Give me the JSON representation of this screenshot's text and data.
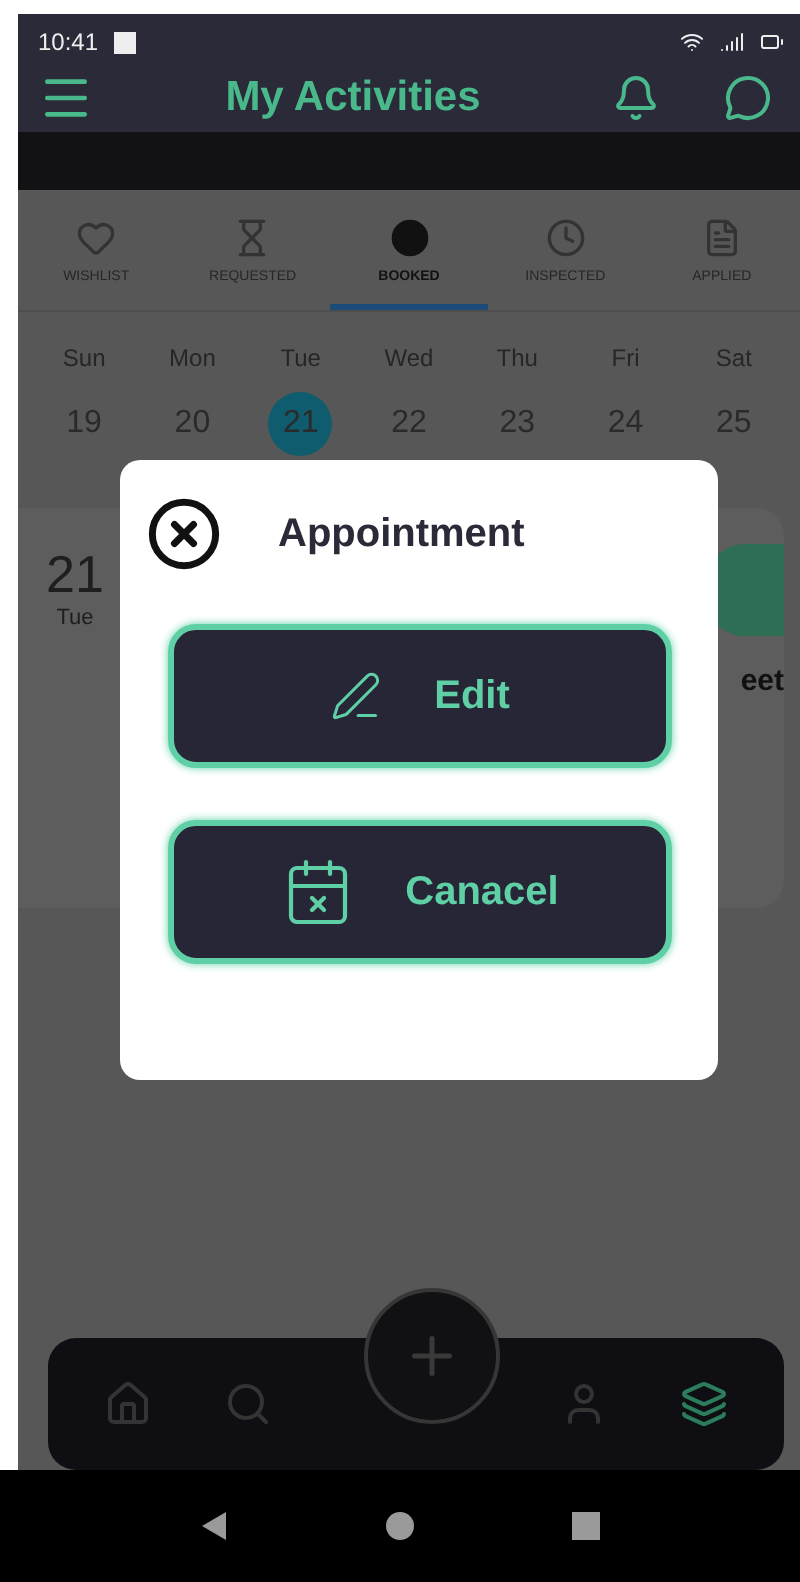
{
  "status_bar": {
    "time": "10:41"
  },
  "header": {
    "title": "My Activities"
  },
  "tabs": [
    {
      "label": "WISHLIST",
      "selected": false
    },
    {
      "label": "REQUESTED",
      "selected": false
    },
    {
      "label": "BOOKED",
      "selected": true
    },
    {
      "label": "INSPECTED",
      "selected": false
    },
    {
      "label": "APPLIED",
      "selected": false
    }
  ],
  "calendar": {
    "days": [
      {
        "name": "Sun",
        "date": "19",
        "selected": false
      },
      {
        "name": "Mon",
        "date": "20",
        "selected": false
      },
      {
        "name": "Tue",
        "date": "21",
        "selected": true
      },
      {
        "name": "Wed",
        "date": "22",
        "selected": false
      },
      {
        "name": "Thu",
        "date": "23",
        "selected": false
      },
      {
        "name": "Fri",
        "date": "24",
        "selected": false
      },
      {
        "name": "Sat",
        "date": "25",
        "selected": false
      }
    ]
  },
  "card": {
    "date": "21",
    "weekday": "Tue",
    "text": "eet"
  },
  "dialog": {
    "title": "Appointment",
    "actions": [
      {
        "label": "Edit"
      },
      {
        "label": "Canacel"
      }
    ]
  },
  "bottom_nav": {
    "items": [
      {
        "selected": false
      },
      {
        "selected": false
      },
      {
        "selected": false
      },
      {
        "selected": true
      }
    ]
  }
}
